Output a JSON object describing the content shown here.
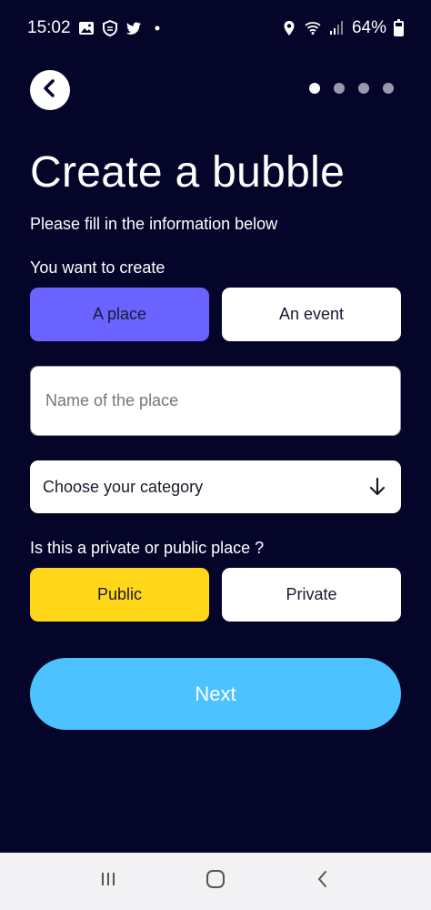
{
  "status_bar": {
    "time": "15:02",
    "battery": "64%",
    "icons_left": [
      "gallery-icon",
      "vpn-shield-icon",
      "twitter-icon",
      "notification-dot-icon"
    ],
    "icons_right": [
      "location-icon",
      "wifi-icon",
      "signal-icon",
      "battery-icon"
    ]
  },
  "header": {
    "back_icon": "chevron-left-icon",
    "steps_total": 4,
    "step_current": 1
  },
  "title": "Create a bubble",
  "subtitle": "Please fill in the information below",
  "create_type": {
    "label": "You want to create",
    "options": [
      "A place",
      "An event"
    ],
    "selected": "A place"
  },
  "name_field": {
    "placeholder": "Name of the place",
    "value": ""
  },
  "category": {
    "label": "Choose your category",
    "icon": "arrow-down-icon"
  },
  "privacy": {
    "label": "Is this a private or public place ?",
    "options": [
      "Public",
      "Private"
    ],
    "selected": "Public"
  },
  "next_button": "Next",
  "colors": {
    "background": "#05052a",
    "selected_type": "#6a63ff",
    "selected_privacy": "#ffd718",
    "next": "#4cc2ff"
  },
  "nav_bar": [
    "recent-apps-icon",
    "home-icon",
    "back-icon"
  ]
}
